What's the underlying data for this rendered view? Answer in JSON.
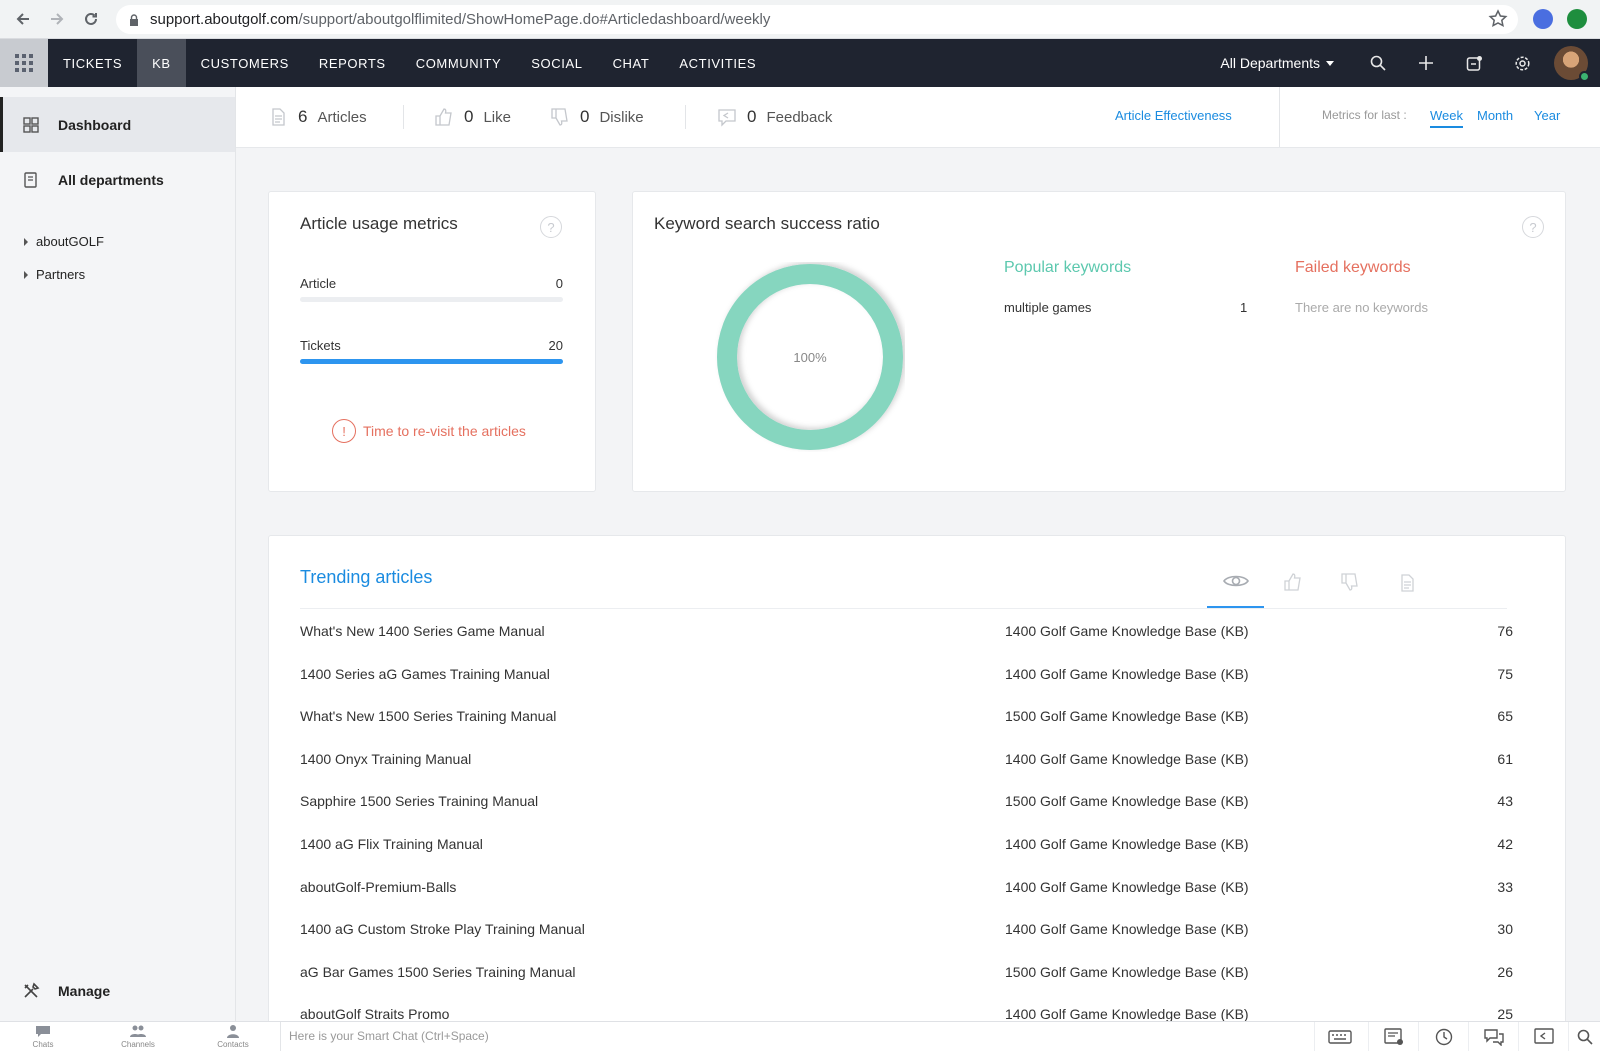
{
  "browser": {
    "url_host": "support.aboutgolf.com",
    "url_path": "/support/aboutgolflimited/ShowHomePage.do#Articledashboard/weekly"
  },
  "topnav": {
    "items": [
      {
        "label": "TICKETS"
      },
      {
        "label": "KB",
        "active": true
      },
      {
        "label": "CUSTOMERS"
      },
      {
        "label": "REPORTS"
      },
      {
        "label": "COMMUNITY"
      },
      {
        "label": "SOCIAL"
      },
      {
        "label": "CHAT"
      },
      {
        "label": "ACTIVITIES"
      }
    ],
    "department": "All Departments",
    "icons": [
      "search-icon",
      "plus-icon",
      "compose-icon",
      "gear-icon"
    ]
  },
  "sidebar": {
    "dashboard": "Dashboard",
    "all_departments": "All departments",
    "tree": [
      "aboutGOLF",
      "Partners"
    ],
    "manage": "Manage"
  },
  "stats": {
    "articles_count": "6",
    "articles_label": "Articles",
    "like_count": "0",
    "like_label": "Like",
    "dislike_count": "0",
    "dislike_label": "Dislike",
    "feedback_count": "0",
    "feedback_label": "Feedback",
    "article_effectiveness": "Article Effectiveness",
    "metrics_label": "Metrics for last :",
    "periods": [
      "Week",
      "Month",
      "Year"
    ],
    "active_period": "Week"
  },
  "usage": {
    "title": "Article usage metrics",
    "rows": [
      {
        "label": "Article",
        "value": "0",
        "fill": 0
      },
      {
        "label": "Tickets",
        "value": "20",
        "fill": 1
      }
    ],
    "warning": "Time to re-visit the articles"
  },
  "keyword": {
    "title": "Keyword search success ratio",
    "ratio_label": "100%",
    "ratio": 1,
    "ring_color": "#86d6bf",
    "popular_title": "Popular keywords",
    "failed_title": "Failed keywords",
    "popular": [
      {
        "keyword": "multiple games",
        "count": "1"
      }
    ],
    "failed_empty": "There are no keywords"
  },
  "trending": {
    "title": "Trending articles",
    "tabs": [
      "eye-icon",
      "thumbs-up-icon",
      "thumbs-down-icon",
      "document-icon"
    ],
    "rows": [
      {
        "name": "What's New 1400 Series Game Manual",
        "kb": "1400 Golf Game Knowledge Base (KB)",
        "views": "76"
      },
      {
        "name": "1400 Series aG Games Training Manual",
        "kb": "1400 Golf Game Knowledge Base (KB)",
        "views": "75"
      },
      {
        "name": "What's New 1500 Series Training Manual",
        "kb": "1500 Golf Game Knowledge Base (KB)",
        "views": "65"
      },
      {
        "name": "1400 Onyx Training Manual",
        "kb": "1400 Golf Game Knowledge Base (KB)",
        "views": "61"
      },
      {
        "name": "Sapphire 1500 Series Training Manual",
        "kb": "1500 Golf Game Knowledge Base (KB)",
        "views": "43"
      },
      {
        "name": "1400 aG Flix Training Manual",
        "kb": "1400 Golf Game Knowledge Base (KB)",
        "views": "42"
      },
      {
        "name": "aboutGolf-Premium-Balls",
        "kb": "1400 Golf Game Knowledge Base (KB)",
        "views": "33"
      },
      {
        "name": "1400 aG Custom Stroke Play Training Manual",
        "kb": "1400 Golf Game Knowledge Base (KB)",
        "views": "30"
      },
      {
        "name": "aG Bar Games 1500 Series Training Manual",
        "kb": "1500 Golf Game Knowledge Base (KB)",
        "views": "26"
      },
      {
        "name": "aboutGolf Straits Promo",
        "kb": "1400 Golf Game Knowledge Base (KB)",
        "views": "25"
      }
    ]
  },
  "bottom_bar": {
    "chats": "Chats",
    "channels": "Channels",
    "contacts": "Contacts",
    "smart_chat_placeholder": "Here is your Smart Chat (Ctrl+Space)"
  }
}
